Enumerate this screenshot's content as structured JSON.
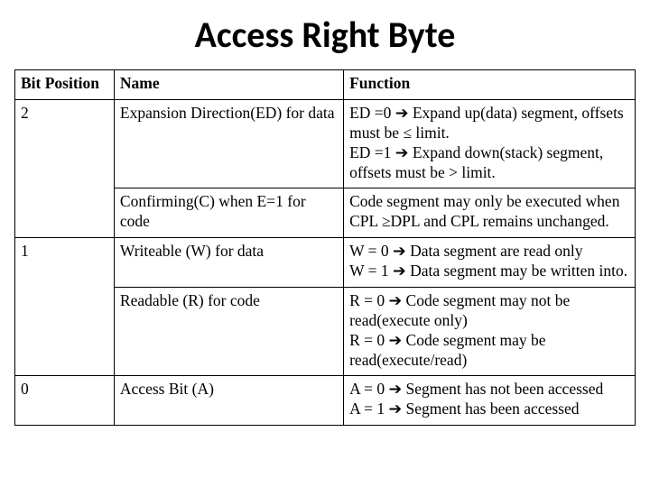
{
  "title": "Access Right Byte",
  "headers": {
    "bit": "Bit Position",
    "name": "Name",
    "func": "Function"
  },
  "rows": [
    {
      "bit": "2",
      "name": "Expansion Direction(ED)  for data",
      "func": "ED =0 ➔ Expand up(data) segment, offsets must be ≤ limit.\nED =1 ➔ Expand down(stack) segment, offsets must be > limit."
    },
    {
      "bit": "",
      "name": "Confirming(C) when E=1 for code",
      "func": "Code segment may only be executed when CPL ≥DPL and CPL remains unchanged."
    },
    {
      "bit": "1",
      "name": "Writeable (W) for data",
      "func": "W = 0 ➔ Data segment are read only\nW = 1 ➔ Data segment may be written into."
    },
    {
      "bit": "",
      "name": "Readable (R) for code",
      "func": "R = 0 ➔ Code segment may not be read(execute only)\nR = 0 ➔ Code segment may be read(execute/read)"
    },
    {
      "bit": "0",
      "name": "Access Bit (A)",
      "func": "A = 0 ➔ Segment has not been accessed\nA = 1 ➔ Segment has been accessed"
    }
  ],
  "chart_data": {
    "type": "table",
    "title": "Access Right Byte",
    "columns": [
      "Bit Position",
      "Name",
      "Function"
    ],
    "rows": [
      [
        "2",
        "Expansion Direction(ED) for data",
        "ED=0 → Expand up(data) segment, offsets must be ≤ limit. ED=1 → Expand down(stack) segment, offsets must be > limit."
      ],
      [
        "",
        "Confirming(C) when E=1 for code",
        "Code segment may only be executed when CPL ≥ DPL and CPL remains unchanged."
      ],
      [
        "1",
        "Writeable (W) for data",
        "W=0 → Data segment are read only. W=1 → Data segment may be written into."
      ],
      [
        "",
        "Readable (R) for code",
        "R=0 → Code segment may not be read (execute only). R=0 → Code segment may be read (execute/read)."
      ],
      [
        "0",
        "Access Bit (A)",
        "A=0 → Segment has not been accessed. A=1 → Segment has been accessed."
      ]
    ]
  }
}
